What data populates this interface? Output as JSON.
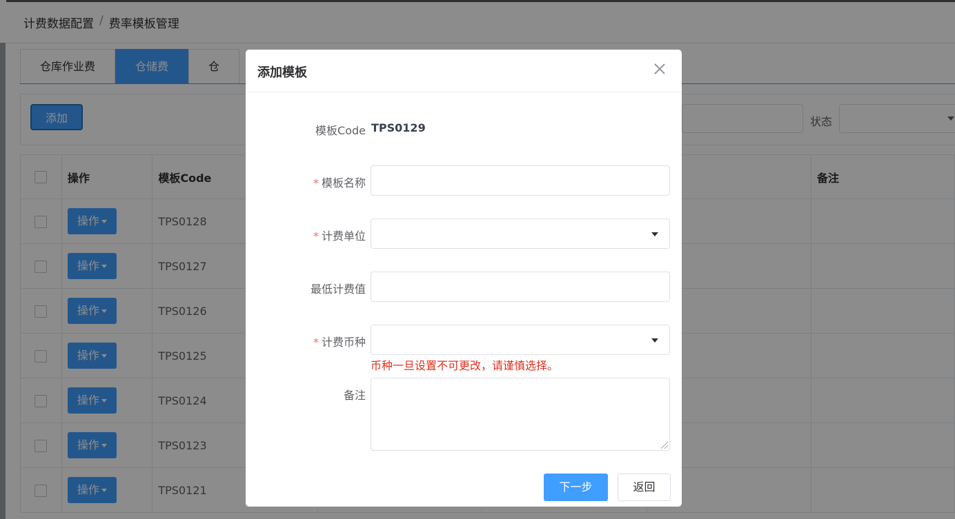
{
  "breadcrumb": {
    "parent": "计费数据配置",
    "separator": "/",
    "current": "费率模板管理"
  },
  "tabs": [
    {
      "label": "仓库作业费",
      "active": false
    },
    {
      "label": "仓储费",
      "active": true
    },
    {
      "label": "仓",
      "active": false
    }
  ],
  "toolbar": {
    "add_label": "添加",
    "status_label": "状态",
    "status_value": ""
  },
  "table": {
    "headers": {
      "op": "操作",
      "code": "模板Code",
      "remark": "备注"
    },
    "op_button_label": "操作",
    "rows": [
      {
        "code": "TPS0128"
      },
      {
        "code": "TPS0127"
      },
      {
        "code": "TPS0126"
      },
      {
        "code": "TPS0125"
      },
      {
        "code": "TPS0124"
      },
      {
        "code": "TPS0123"
      },
      {
        "code": "TPS0121"
      }
    ]
  },
  "dialog": {
    "title": "添加模板",
    "required_mark": "*",
    "code_label": "模板Code",
    "code_value": "TPS0129",
    "name_label": "模板名称",
    "name_value": "",
    "unit_label": "计费单位",
    "unit_value": "",
    "min_label": "最低计费值",
    "min_value": "",
    "currency_label": "计费币种",
    "currency_value": "",
    "currency_warning": "币种一旦设置不可更改，请谨慎选择。",
    "remark_label": "备注",
    "remark_value": "",
    "next_label": "下一步",
    "back_label": "返回"
  },
  "colors": {
    "primary": "#409eff",
    "required": "#f56c6c",
    "warning": "#e0311f"
  }
}
